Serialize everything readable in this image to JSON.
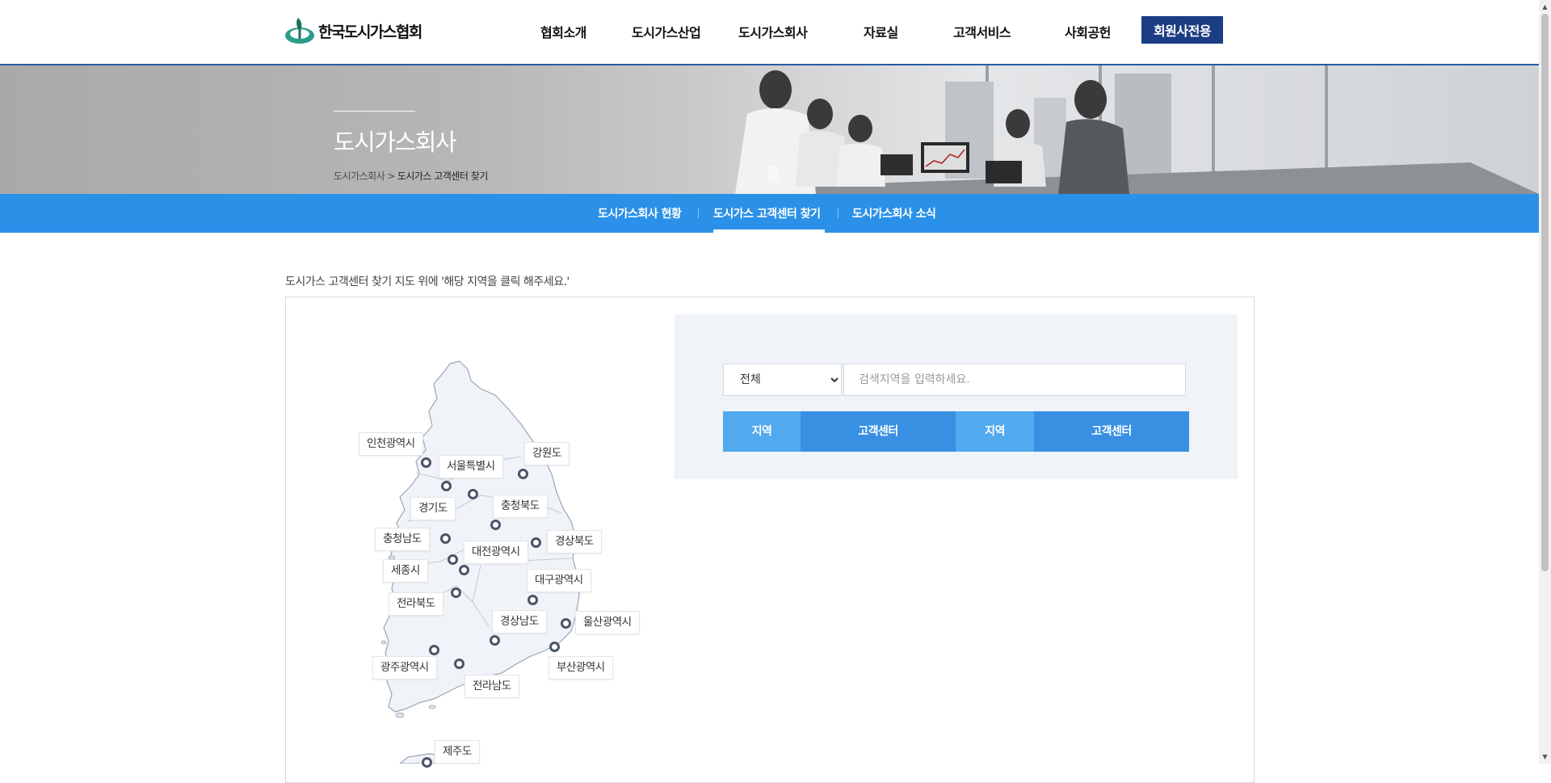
{
  "header": {
    "logo_text": "한국도시가스협회",
    "nav": [
      {
        "label": "협회소개"
      },
      {
        "label": "도시가스산업"
      },
      {
        "label": "도시가스회사"
      },
      {
        "label": "자료실"
      },
      {
        "label": "고객서비스"
      },
      {
        "label": "사회공헌"
      }
    ],
    "member_button": "회원사전용",
    "brand_color": "#1b3d83"
  },
  "visual": {
    "title": "도시가스회사",
    "breadcrumb": {
      "parent": "도시가스회사",
      "separator": ">",
      "current": "도시가스 고객센터 찾기"
    }
  },
  "subnav": {
    "items": [
      {
        "label": "도시가스회사 현황"
      },
      {
        "label": "도시가스 고객센터 찾기"
      },
      {
        "label": "도시가스회사 소식"
      }
    ],
    "active": "도시가스 고객센터 찾기",
    "color": "#2b91e8"
  },
  "content": {
    "notice": "도시가스 고객센터 찾기 지도 위에 '해당 지역을 클릭 해주세요.'",
    "map": {
      "regions": [
        {
          "label": "인천광역시"
        },
        {
          "label": "서울특별시"
        },
        {
          "label": "강원도"
        },
        {
          "label": "경기도"
        },
        {
          "label": "충청북도"
        },
        {
          "label": "충청남도"
        },
        {
          "label": "대전광역시"
        },
        {
          "label": "경상북도"
        },
        {
          "label": "세종시"
        },
        {
          "label": "대구광역시"
        },
        {
          "label": "전라북도"
        },
        {
          "label": "경상남도"
        },
        {
          "label": "울산광역시"
        },
        {
          "label": "광주광역시"
        },
        {
          "label": "부산광역시"
        },
        {
          "label": "전라남도"
        },
        {
          "label": "제주도"
        }
      ]
    },
    "search": {
      "select_options": [
        "전체"
      ],
      "selected": "전체",
      "input_placeholder": "검색지역을 입력하세요.",
      "input_value": "",
      "table_headers": [
        "지역",
        "고객센터",
        "지역",
        "고객센터"
      ]
    }
  }
}
